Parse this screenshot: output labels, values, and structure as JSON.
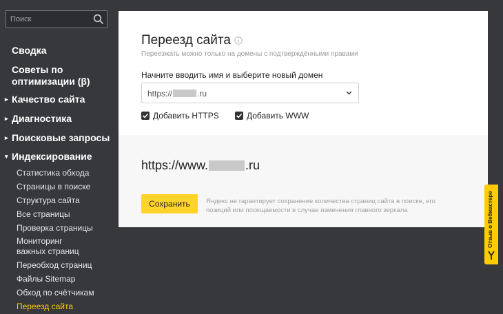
{
  "sidebar": {
    "search_placeholder": "Поиск",
    "items": [
      {
        "label": "Сводка"
      },
      {
        "label": "Советы по"
      },
      {
        "label": "оптимизации (β)"
      },
      {
        "label": "Качество сайта"
      },
      {
        "label": "Диагностика"
      },
      {
        "label": "Поисковые запросы"
      },
      {
        "label": "Индексирование"
      }
    ],
    "subitems": [
      {
        "label": "Статистика обхода"
      },
      {
        "label": "Страницы в поиске"
      },
      {
        "label": "Структура сайта"
      },
      {
        "label": "Все страницы"
      },
      {
        "label": "Проверка страницы"
      },
      {
        "label": "Мониторинг"
      },
      {
        "label": "важных страниц"
      },
      {
        "label": "Переобход страниц"
      },
      {
        "label": "Файлы Sitemap"
      },
      {
        "label": "Обход по счётчикам"
      },
      {
        "label": "Переезд сайта"
      }
    ]
  },
  "main": {
    "title": "Переезд сайта",
    "subtitle": "Переезжать можно только на домены с подтверждёнными правами",
    "field_label": "Начните вводить имя и выберите новый домен",
    "domain_prefix": "https://",
    "domain_suffix": ".ru",
    "https_label": "Добавить HTTPS",
    "www_label": "Добавить WWW",
    "new_domain_prefix": "https://www.",
    "new_domain_suffix": ".ru",
    "save_label": "Сохранить",
    "note": "Яндекс не гарантирует сохранение количества страниц сайта в поиске, его позиций или посещаемости в случае изменения главного зеркала"
  },
  "feedback": {
    "label": "Отзыв о Вебмастере"
  },
  "colors": {
    "background": "#37383c",
    "accent": "#ffcc00",
    "button": "#ffd42a",
    "active_nav": "#ffcc00"
  }
}
